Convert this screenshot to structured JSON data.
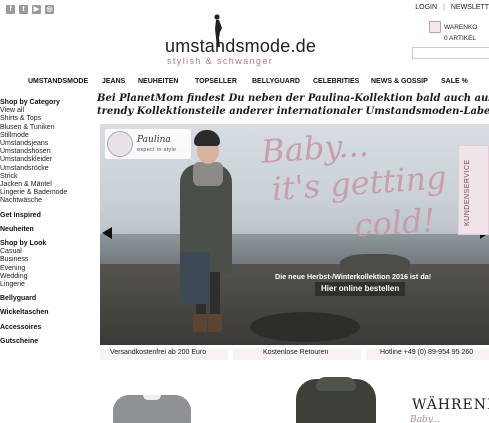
{
  "topbar": {
    "social_icons": [
      "facebook-icon",
      "twitter-icon",
      "youtube-icon",
      "instagram-icon"
    ],
    "login": "LOGIN",
    "newsletter": "NEWSLETT"
  },
  "logo": {
    "name": "umstandsmode.de",
    "slogan": "stylish & schwanger"
  },
  "cart": {
    "label": "WARENKO",
    "count": "0 ARTIKEL"
  },
  "nav": [
    "UMSTANDSMODE",
    "JEANS",
    "NEUHEITEN",
    "TOPSELLER",
    "BELLYGUARD",
    "CELEBRITIES",
    "NEWS & GOSSIP",
    "SALE %"
  ],
  "sidebar": {
    "category_heading": "Shop by Category",
    "categories": [
      "View all",
      "Shirts & Tops",
      "Blusen & Tuniken",
      "Stillmode",
      "Umstandsjeans",
      "Umstandshosen",
      "Umstandskleider",
      "Umstandsröcke",
      "Strick",
      "Jacken & Mäntel",
      "Lingerie & Bademode",
      "Nachtwäsche"
    ],
    "inspired": "Get Inspired",
    "neuheiten": "Neuheiten",
    "look_heading": "Shop by Look",
    "looks": [
      "Casual",
      "Business",
      "Evening",
      "Wedding",
      "Lingerie"
    ],
    "bellyguard": "Bellyguard",
    "wickeltaschen": "Wickeltaschen",
    "accessoires": "Accessoires",
    "gutscheine": "Gutscheine"
  },
  "tagline": {
    "line1": "Bei PlanetMom findest Du neben der Paulina-Kollektion bald auch ausgewählte",
    "line2": "trendy Kollektionsteile anderer internationaler Umstandsmoden-Labels..."
  },
  "hero": {
    "brand": "Paulina",
    "brand_sub": "expect in style",
    "headline1": "Baby...",
    "headline2": "it's getting",
    "headline3": "cold!",
    "promo": "Die neue Herbst-/Winterkollektion 2016 ist da!",
    "cta": "Hier online bestellen",
    "kundenservice": "KUNDENSERVICE"
  },
  "infobar": [
    "Versandkostenfrei ab 200 Euro",
    "Kostenlose Retouren",
    "Hotline +49 (0) 89-954 95 260"
  ],
  "bottom": {
    "heading": "WÄHREND DE",
    "sub": "Baby..."
  }
}
